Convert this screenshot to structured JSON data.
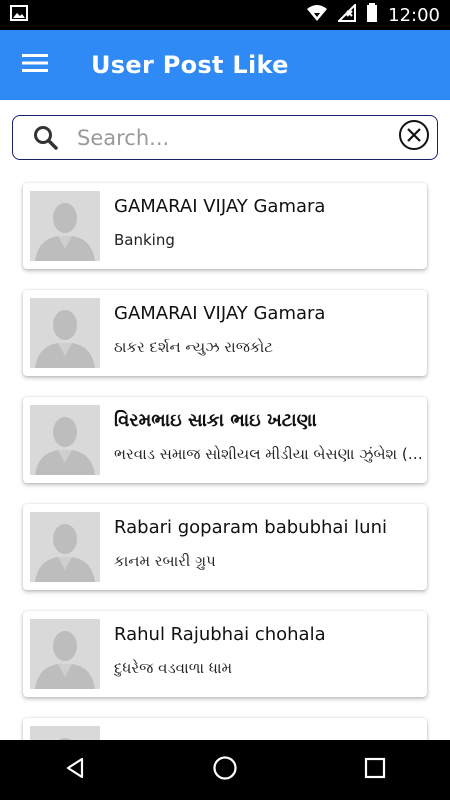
{
  "status_bar": {
    "time": "12:00",
    "icons": [
      "image-icon",
      "wifi-icon",
      "signal-icon",
      "battery-icon"
    ]
  },
  "app_bar": {
    "title": "User Post Like",
    "menu_icon": "hamburger-menu-icon",
    "color": "#2f8af5"
  },
  "search": {
    "placeholder": "Search...",
    "value": "",
    "icons": [
      "search-icon",
      "clear-icon"
    ]
  },
  "users": [
    {
      "name": "GAMARAI VIJAY Gamara",
      "subtitle": "Banking"
    },
    {
      "name": "GAMARAI VIJAY Gamara",
      "subtitle": "ઠાકર દર્શન ન્યુઝ રાજકોટ"
    },
    {
      "name": "વિરમભાઇ સાકા ભાઇ ખટાણા",
      "subtitle": "ભરવાડ સમાજ સોશીયલ મીડીયા બેસણા ઝુંબેશ (ભરવાડ સમાજ)"
    },
    {
      "name": "Rabari goparam babubhai luni",
      "subtitle": "કાનમ રબારી ગ્રુપ"
    },
    {
      "name": "Rahul Rajubhai chohala",
      "subtitle": "દુધરેજ વડવાળા ધામ"
    },
    {
      "name": "",
      "subtitle": ""
    }
  ],
  "nav_bar": {
    "icons": [
      "back-icon",
      "home-icon",
      "recents-icon"
    ]
  }
}
